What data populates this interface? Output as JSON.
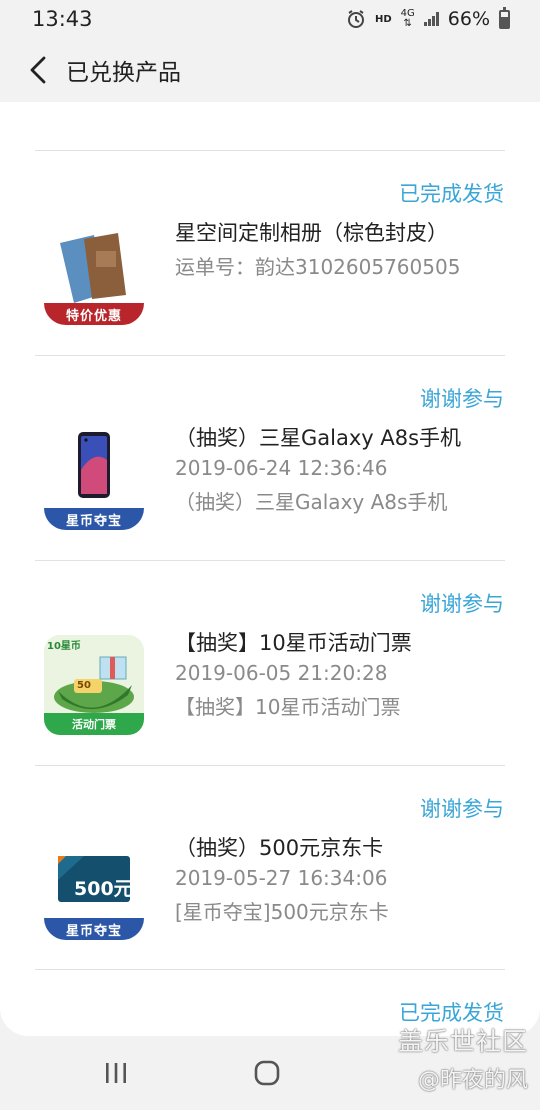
{
  "status_bar": {
    "time": "13:43",
    "hd": "HD",
    "network": "4G",
    "battery": "66%"
  },
  "header": {
    "title": "已兑换产品"
  },
  "items": [
    {
      "status": "已完成发货",
      "title": "星空间定制相册（棕色封皮）",
      "line2": "运单号：韵达3102605760505",
      "line3": "",
      "badge": "特价优惠",
      "thumb": "photo-album"
    },
    {
      "status": "谢谢参与",
      "title": "（抽奖）三星Galaxy A8s手机",
      "line2": "2019-06-24 12:36:46",
      "line3": "（抽奖）三星Galaxy A8s手机",
      "badge": "星币夺宝",
      "thumb": "phone"
    },
    {
      "status": "谢谢参与",
      "title": "【抽奖】10星币活动门票",
      "line2": "2019-06-05 21:20:28",
      "line3": "【抽奖】10星币活动门票",
      "badge": "活动门票",
      "thumb_top": "10星币",
      "thumb_value": "50",
      "thumb": "activity-ticket"
    },
    {
      "status": "谢谢参与",
      "title": "（抽奖）500元京东卡",
      "line2": "2019-05-27 16:34:06",
      "line3": "[星币夺宝]500元京东卡",
      "badge": "星币夺宝",
      "thumb_value": "500元",
      "thumb": "jd-card"
    },
    {
      "status": "已完成发货"
    }
  ],
  "watermark": {
    "line1": "盖乐世社区",
    "line2": "@昨夜的风"
  }
}
